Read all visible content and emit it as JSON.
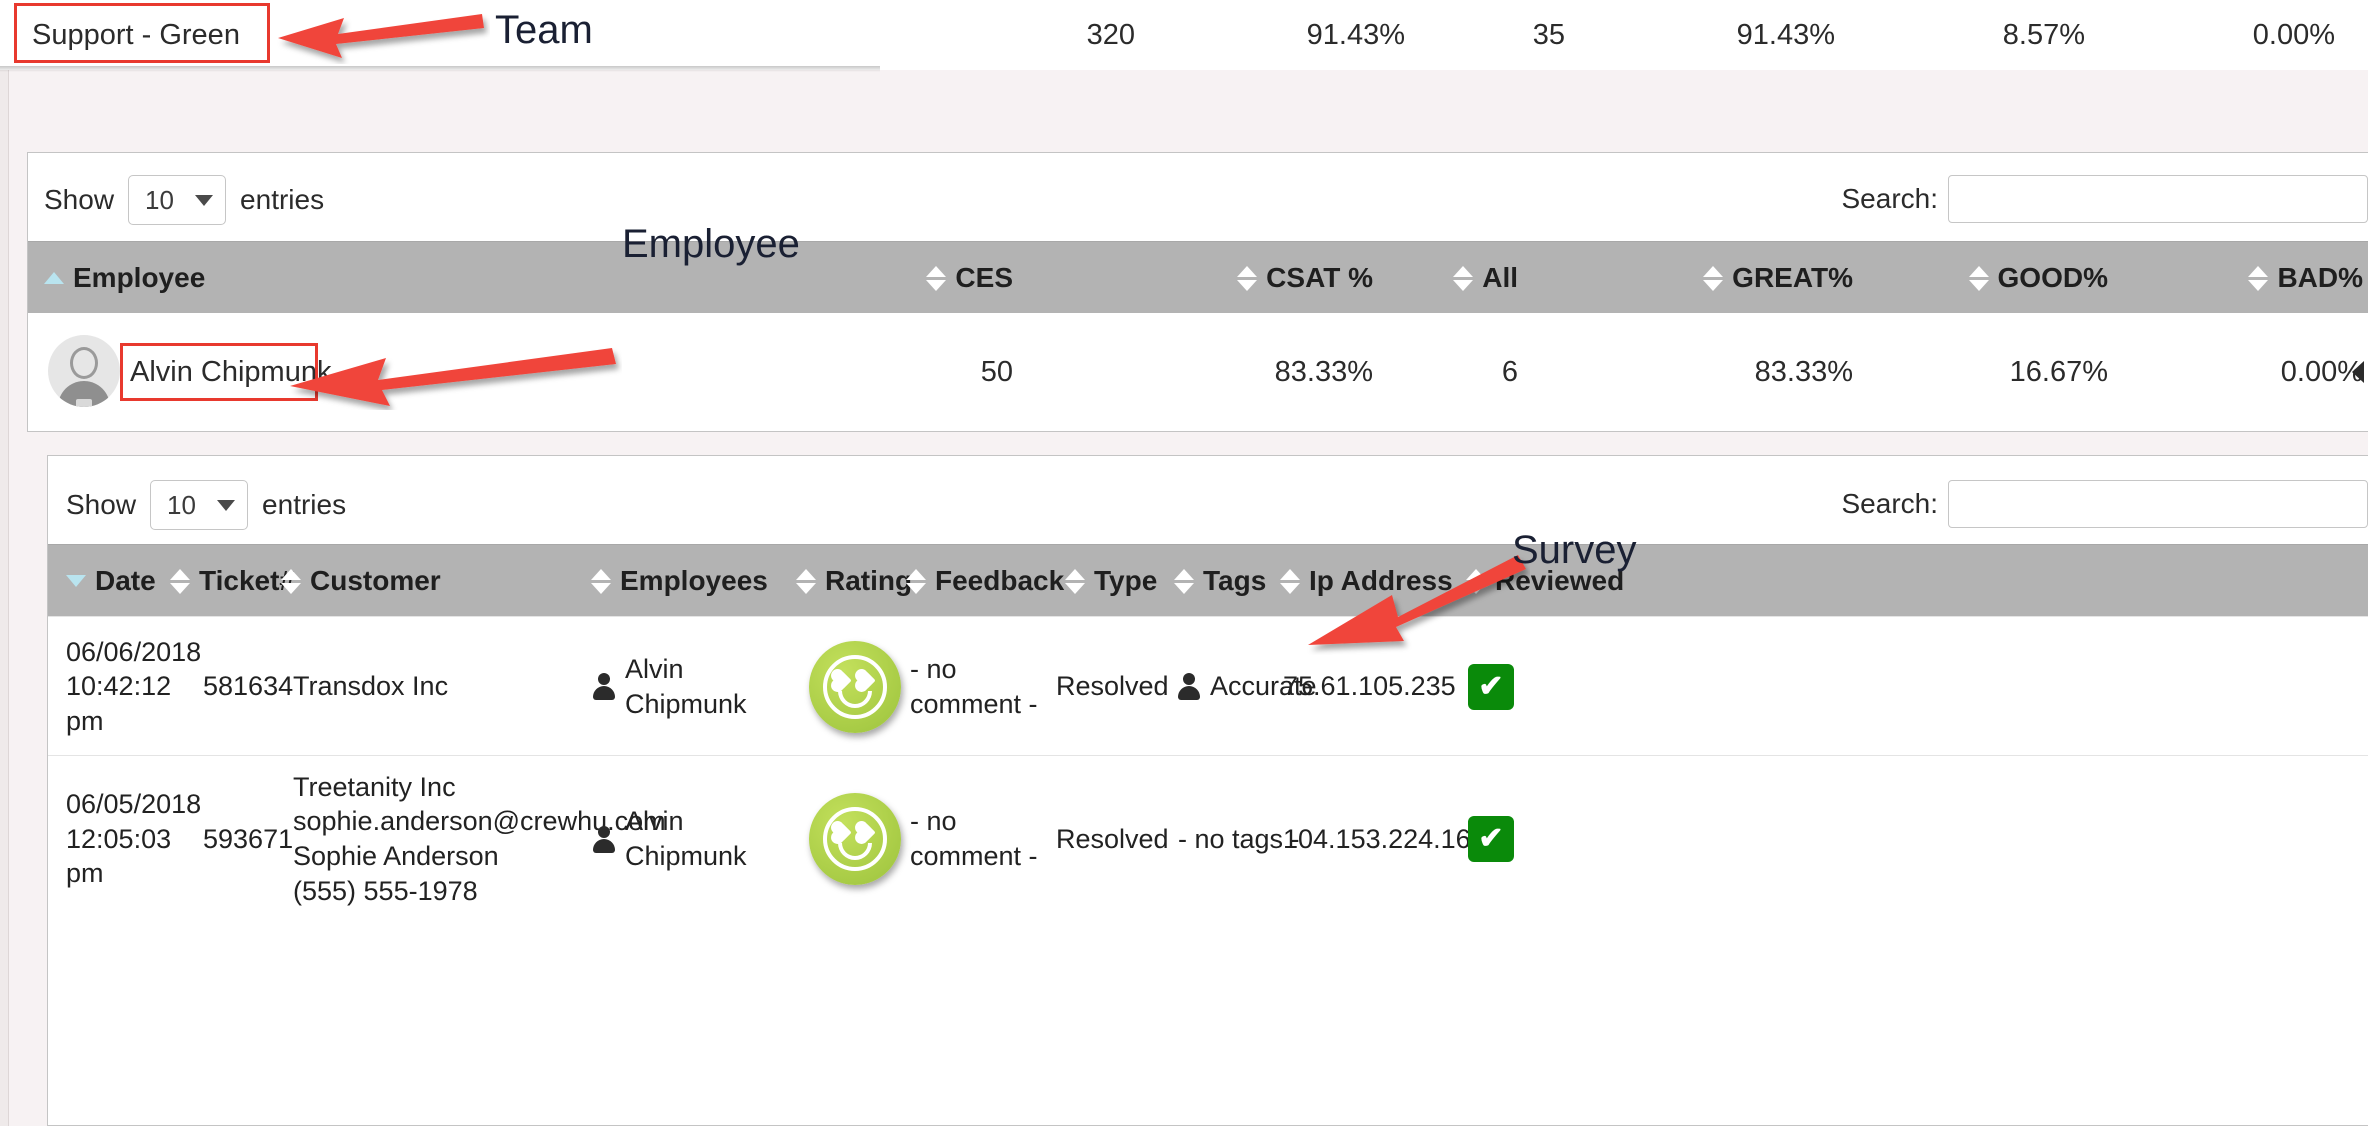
{
  "team_summary": {
    "name": "Support - Green",
    "ces": "320",
    "csat_pct": "91.43%",
    "all": "35",
    "great_pct": "91.43%",
    "good_pct": "8.57%",
    "bad_pct": "0.00%"
  },
  "annotations": [
    {
      "label": "Team"
    },
    {
      "label": "Employee"
    },
    {
      "label": "Survey"
    }
  ],
  "employee_table": {
    "show_label": "Show",
    "entries_value": "10",
    "entries_label": "entries",
    "search_label": "Search:",
    "search_value": "",
    "columns": [
      {
        "label": "Employee",
        "sort": "asc"
      },
      {
        "label": "CES",
        "sort": "both"
      },
      {
        "label": "CSAT %",
        "sort": "both"
      },
      {
        "label": "All",
        "sort": "both"
      },
      {
        "label": "GREAT%",
        "sort": "both"
      },
      {
        "label": "GOOD%",
        "sort": "both"
      },
      {
        "label": "BAD%",
        "sort": "both"
      }
    ],
    "row": {
      "avatar": "user-avatar",
      "name": "Alvin Chipmunk",
      "ces": "50",
      "csat_pct": "83.33%",
      "all": "6",
      "great_pct": "83.33%",
      "good_pct": "16.67%",
      "bad_pct": "0.00%"
    }
  },
  "survey_table": {
    "show_label": "Show",
    "entries_value": "10",
    "entries_label": "entries",
    "search_label": "Search:",
    "search_value": "",
    "columns": [
      {
        "label": "Date",
        "sort": "desc"
      },
      {
        "label": "Ticket#",
        "sort": "both"
      },
      {
        "label": "Customer",
        "sort": "both"
      },
      {
        "label": "Employees",
        "sort": "both"
      },
      {
        "label": "Rating",
        "sort": "both"
      },
      {
        "label": "Feedback",
        "sort": "both"
      },
      {
        "label": "Type",
        "sort": "both"
      },
      {
        "label": "Tags",
        "sort": "both"
      },
      {
        "label": "Ip Address",
        "sort": "both"
      },
      {
        "label": "Reviewed",
        "sort": "both"
      }
    ],
    "rows": [
      {
        "date_lines": [
          "06/06/2018",
          "10:42:12",
          "pm"
        ],
        "ticket": "581634",
        "customer_lines": [
          "Transdox Inc"
        ],
        "employee": "Alvin Chipmunk",
        "rating": "great-smiley-icon",
        "feedback_lines": [
          "- no",
          "comment -"
        ],
        "type": "Resolved",
        "tags": "Accurate",
        "tags_has_icon": true,
        "ip": "75.61.105.235",
        "reviewed": "✔"
      },
      {
        "date_lines": [
          "06/05/2018",
          "12:05:03",
          "pm"
        ],
        "ticket": "593671",
        "customer_lines": [
          "Treetanity Inc",
          "sophie.anderson@crewhu.com",
          "Sophie Anderson",
          "(555) 555-1978"
        ],
        "employee": "Alvin Chipmunk",
        "rating": "great-smiley-icon",
        "feedback_lines": [
          "- no",
          "comment -"
        ],
        "type": "Resolved",
        "tags": "- no tags -",
        "tags_has_icon": false,
        "ip": "104.153.224.165",
        "reviewed": "✔"
      }
    ]
  },
  "colors": {
    "highlight_border": "#e8392e",
    "header_bg": "#b3b3b3",
    "sort_active": "#b9e4ef",
    "rating_green": "#aed04a",
    "check_green": "#0a8a0a"
  }
}
